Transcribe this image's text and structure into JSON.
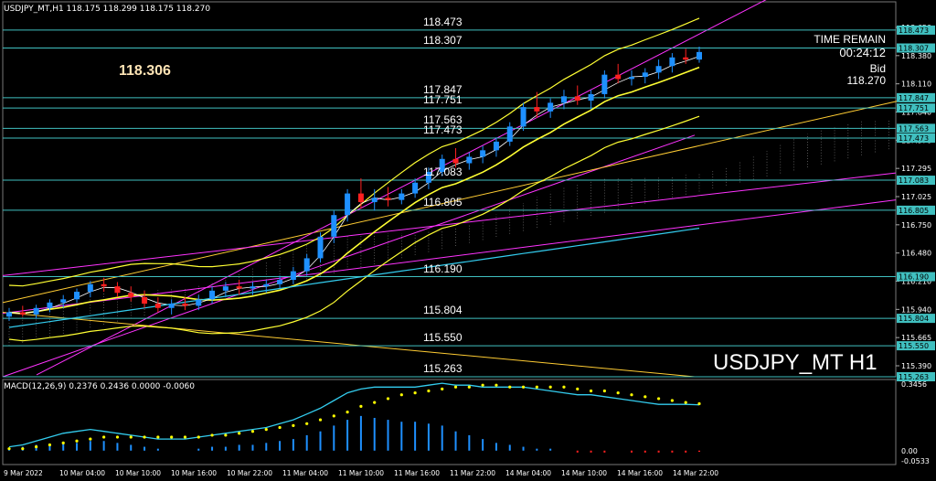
{
  "header": {
    "info": "USDJPY_MT,H1  118.175 118.299 118.175 118.270",
    "macd_info": "MACD(12,26,9) 0.2376 0.2436 0.0000 -0.0060"
  },
  "big_price": "118.306",
  "symbol_label": "USDJPY_MT H1",
  "time_remain": {
    "label": "TIME REMAIN",
    "value": "00:24:12",
    "bid_label": "Bid",
    "bid_value": "118.270"
  },
  "levels": [
    {
      "text": "118.473",
      "value": 118.473
    },
    {
      "text": "118.307",
      "value": 118.307
    },
    {
      "text": "117.847",
      "value": 117.847
    },
    {
      "text": "117.751",
      "value": 117.751
    },
    {
      "text": "117.563",
      "value": 117.563
    },
    {
      "text": "117.473",
      "value": 117.473
    },
    {
      "text": "117.083",
      "value": 117.083
    },
    {
      "text": "116.805",
      "value": 116.805
    },
    {
      "text": "116.190",
      "value": 116.19
    },
    {
      "text": "115.804",
      "value": 115.804
    },
    {
      "text": "115.550",
      "value": 115.55
    },
    {
      "text": "115.263",
      "value": 115.263
    }
  ],
  "colors": {
    "background": "#000000",
    "bull_candle": "#1e90ff",
    "bear_candle": "#ff2020",
    "level_line": "#40c0c0",
    "bollinger": "#ffff33",
    "trend_magenta": "#ff33ff",
    "trend_orange": "#ffcc33",
    "ma_cyan": "#33ccee",
    "macd_signal": "#ffff00",
    "macd_line": "#33ccee"
  },
  "chart_data": {
    "type": "candlestick",
    "symbol": "USDJPY_MT",
    "timeframe": "H1",
    "price_ticks": [
      "118.650",
      "118.380",
      "118.110",
      "117.840",
      "117.570",
      "117.295",
      "117.025",
      "116.750",
      "116.480",
      "116.210",
      "115.940",
      "115.665",
      "115.390"
    ],
    "y_range": [
      115.263,
      118.65
    ],
    "time_labels": [
      "9 Mar 2022",
      "10 Mar 04:00",
      "10 Mar 10:00",
      "10 Mar 16:00",
      "10 Mar 22:00",
      "11 Mar 04:00",
      "11 Mar 10:00",
      "11 Mar 16:00",
      "11 Mar 22:00",
      "14 Mar 04:00",
      "14 Mar 10:00",
      "14 Mar 16:00",
      "14 Mar 22:00"
    ],
    "candles": [
      [
        115.82,
        115.9,
        115.78,
        115.86
      ],
      [
        115.86,
        115.92,
        115.82,
        115.84
      ],
      [
        115.84,
        115.93,
        115.8,
        115.9
      ],
      [
        115.9,
        115.98,
        115.86,
        115.95
      ],
      [
        115.95,
        116.02,
        115.9,
        115.98
      ],
      [
        115.98,
        116.08,
        115.95,
        116.05
      ],
      [
        116.05,
        116.15,
        116.0,
        116.12
      ],
      [
        116.12,
        116.18,
        116.05,
        116.1
      ],
      [
        116.1,
        116.14,
        116.0,
        116.04
      ],
      [
        116.04,
        116.1,
        115.96,
        116.0
      ],
      [
        116.0,
        116.06,
        115.9,
        115.94
      ],
      [
        115.94,
        116.0,
        115.86,
        115.9
      ],
      [
        115.9,
        115.98,
        115.84,
        115.94
      ],
      [
        115.94,
        116.0,
        115.88,
        115.92
      ],
      [
        115.92,
        116.02,
        115.88,
        115.98
      ],
      [
        115.98,
        116.1,
        115.94,
        116.06
      ],
      [
        116.06,
        116.14,
        116.0,
        116.1
      ],
      [
        116.1,
        116.16,
        116.02,
        116.08
      ],
      [
        116.08,
        116.14,
        116.02,
        116.1
      ],
      [
        116.1,
        116.16,
        116.04,
        116.12
      ],
      [
        116.12,
        116.2,
        116.08,
        116.16
      ],
      [
        116.16,
        116.28,
        116.12,
        116.24
      ],
      [
        116.24,
        116.4,
        116.2,
        116.36
      ],
      [
        116.36,
        116.6,
        116.32,
        116.56
      ],
      [
        116.56,
        116.8,
        116.5,
        116.76
      ],
      [
        116.76,
        117.0,
        116.7,
        116.96
      ],
      [
        116.96,
        117.1,
        116.82,
        116.88
      ],
      [
        116.88,
        117.0,
        116.8,
        116.92
      ],
      [
        116.92,
        117.02,
        116.84,
        116.9
      ],
      [
        116.9,
        117.0,
        116.86,
        116.96
      ],
      [
        116.96,
        117.1,
        116.92,
        117.06
      ],
      [
        117.06,
        117.2,
        117.0,
        117.16
      ],
      [
        117.16,
        117.32,
        117.12,
        117.28
      ],
      [
        117.28,
        117.38,
        117.2,
        117.24
      ],
      [
        117.24,
        117.34,
        117.18,
        117.3
      ],
      [
        117.3,
        117.4,
        117.24,
        117.36
      ],
      [
        117.36,
        117.48,
        117.3,
        117.44
      ],
      [
        117.44,
        117.62,
        117.4,
        117.58
      ],
      [
        117.58,
        117.8,
        117.54,
        117.76
      ],
      [
        117.76,
        117.9,
        117.66,
        117.72
      ],
      [
        117.72,
        117.84,
        117.66,
        117.8
      ],
      [
        117.8,
        117.92,
        117.74,
        117.86
      ],
      [
        117.86,
        117.96,
        117.78,
        117.82
      ],
      [
        117.82,
        117.92,
        117.74,
        117.88
      ],
      [
        117.88,
        118.1,
        117.84,
        118.06
      ],
      [
        118.06,
        118.16,
        117.98,
        118.02
      ],
      [
        118.02,
        118.1,
        117.96,
        118.04
      ],
      [
        118.04,
        118.12,
        117.98,
        118.08
      ],
      [
        118.08,
        118.2,
        118.02,
        118.14
      ],
      [
        118.14,
        118.26,
        118.08,
        118.22
      ],
      [
        118.22,
        118.3,
        118.16,
        118.2
      ],
      [
        118.2,
        118.32,
        118.17,
        118.27
      ]
    ],
    "macd": {
      "name": "MACD(12,26,9)",
      "range": [
        -0.0533,
        0.3456
      ],
      "ticks": [
        "0.3456",
        "0.00",
        "-0.0533"
      ],
      "histogram": [
        0.01,
        0.02,
        0.03,
        0.03,
        0.04,
        0.04,
        0.05,
        0.05,
        0.04,
        0.03,
        0.02,
        0.01,
        0.0,
        0.0,
        0.01,
        0.02,
        0.02,
        0.03,
        0.03,
        0.04,
        0.05,
        0.06,
        0.08,
        0.1,
        0.13,
        0.16,
        0.18,
        0.17,
        0.16,
        0.15,
        0.15,
        0.14,
        0.13,
        0.1,
        0.08,
        0.06,
        0.04,
        0.03,
        0.02,
        0.01,
        0.01,
        0.0,
        -0.01,
        -0.01,
        -0.01,
        0.0,
        -0.01,
        -0.01,
        -0.01,
        -0.01,
        -0.01,
        -0.006
      ],
      "main_line": [
        0.02,
        0.03,
        0.05,
        0.07,
        0.09,
        0.1,
        0.11,
        0.1,
        0.09,
        0.08,
        0.07,
        0.06,
        0.06,
        0.06,
        0.07,
        0.08,
        0.09,
        0.1,
        0.11,
        0.12,
        0.14,
        0.16,
        0.19,
        0.22,
        0.26,
        0.3,
        0.32,
        0.33,
        0.33,
        0.33,
        0.33,
        0.34,
        0.35,
        0.34,
        0.34,
        0.33,
        0.33,
        0.33,
        0.33,
        0.32,
        0.31,
        0.3,
        0.29,
        0.29,
        0.28,
        0.27,
        0.26,
        0.25,
        0.24,
        0.24,
        0.24,
        0.2376
      ],
      "signal_line": [
        0.01,
        0.01,
        0.02,
        0.03,
        0.04,
        0.05,
        0.06,
        0.07,
        0.07,
        0.07,
        0.07,
        0.07,
        0.07,
        0.07,
        0.07,
        0.08,
        0.08,
        0.09,
        0.1,
        0.11,
        0.12,
        0.13,
        0.14,
        0.16,
        0.18,
        0.2,
        0.23,
        0.25,
        0.27,
        0.29,
        0.3,
        0.31,
        0.32,
        0.33,
        0.33,
        0.34,
        0.34,
        0.33,
        0.33,
        0.33,
        0.33,
        0.33,
        0.32,
        0.31,
        0.31,
        0.3,
        0.29,
        0.28,
        0.27,
        0.26,
        0.25,
        0.2436
      ]
    }
  }
}
